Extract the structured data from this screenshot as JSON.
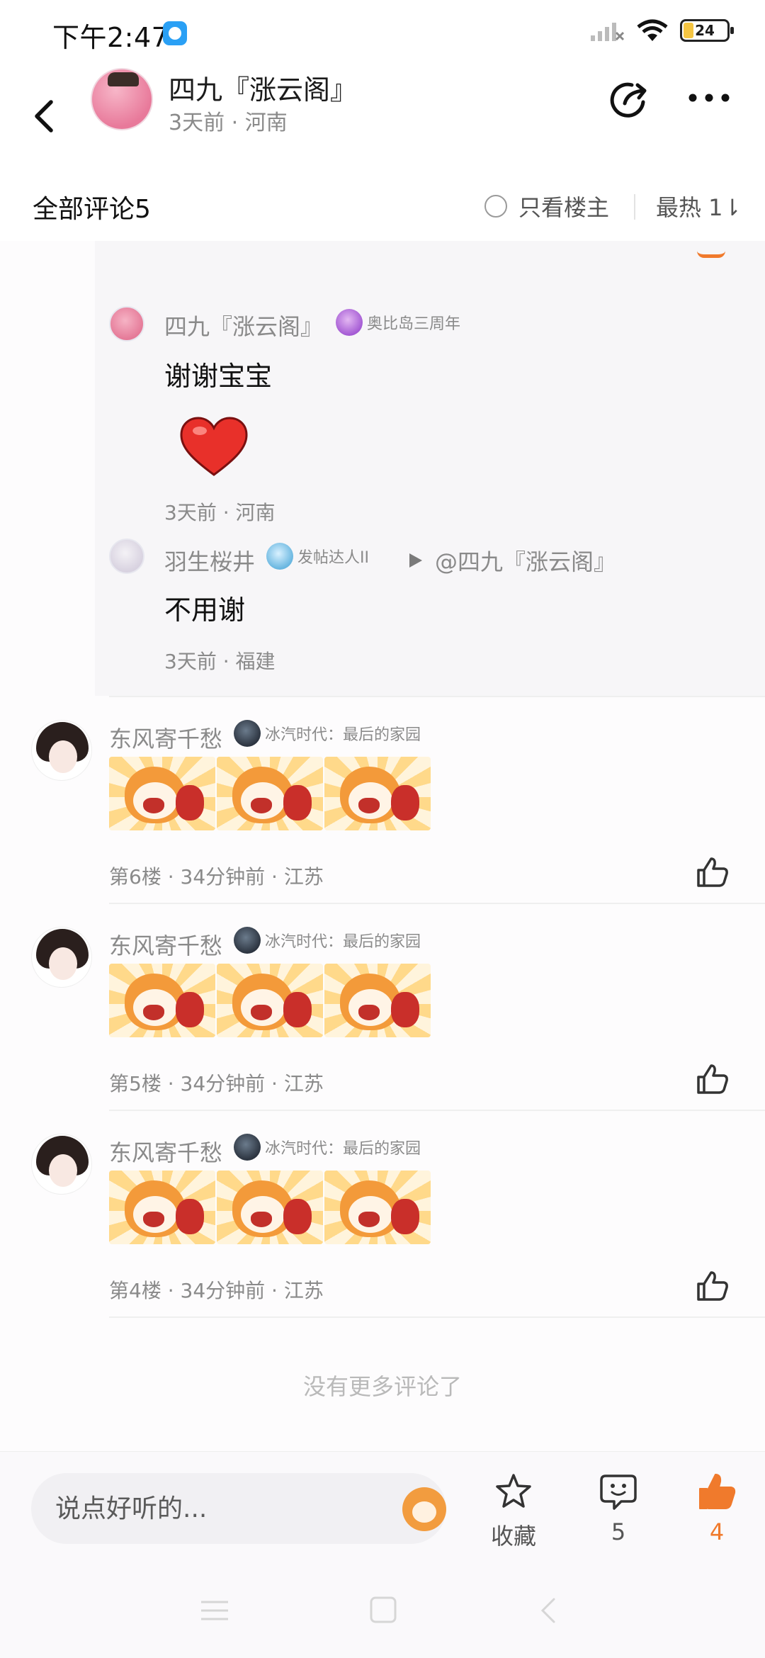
{
  "status_bar": {
    "time": "下午2:47",
    "battery": "24",
    "icons": [
      "signal-icon",
      "wifi-icon",
      "battery-icon"
    ]
  },
  "header": {
    "name": "四九『涨云阁』",
    "meta": "3天前 · 河南",
    "icons": [
      "back-icon",
      "share-icon",
      "more-icon"
    ]
  },
  "comments_bar": {
    "title": "全部评论5",
    "only_op_label": "只看楼主",
    "sort_label": "最热 1⇂"
  },
  "reply_thread": {
    "replies": [
      {
        "name": "四九『涨云阁』",
        "badge": "奥比岛三周年",
        "text": "谢谢宝宝",
        "meta": "3天前 · 河南"
      },
      {
        "name": "羽生桜井",
        "badge": "发帖达人II",
        "reply_to": "@四九『涨云阁』",
        "text": "不用谢",
        "meta": "3天前 · 福建"
      }
    ]
  },
  "floors": [
    {
      "name": "东风寄千愁",
      "badge": "冰汽时代：最后的家园",
      "meta": "第6楼 · 34分钟前 · 江苏"
    },
    {
      "name": "东风寄千愁",
      "badge": "冰汽时代：最后的家园",
      "meta": "第5楼 · 34分钟前 · 江苏"
    },
    {
      "name": "东风寄千愁",
      "badge": "冰汽时代：最后的家园",
      "meta": "第4楼 · 34分钟前 · 江苏"
    }
  ],
  "end_text": "没有更多评论了",
  "bottom_bar": {
    "input_placeholder": "说点好听的...",
    "favorite_label": "收藏",
    "comment_count": "5",
    "like_count": "4"
  },
  "colors": {
    "accent": "#f07a2c",
    "muted_text": "#8a8a8a",
    "reply_bg": "#f7f6f8"
  }
}
